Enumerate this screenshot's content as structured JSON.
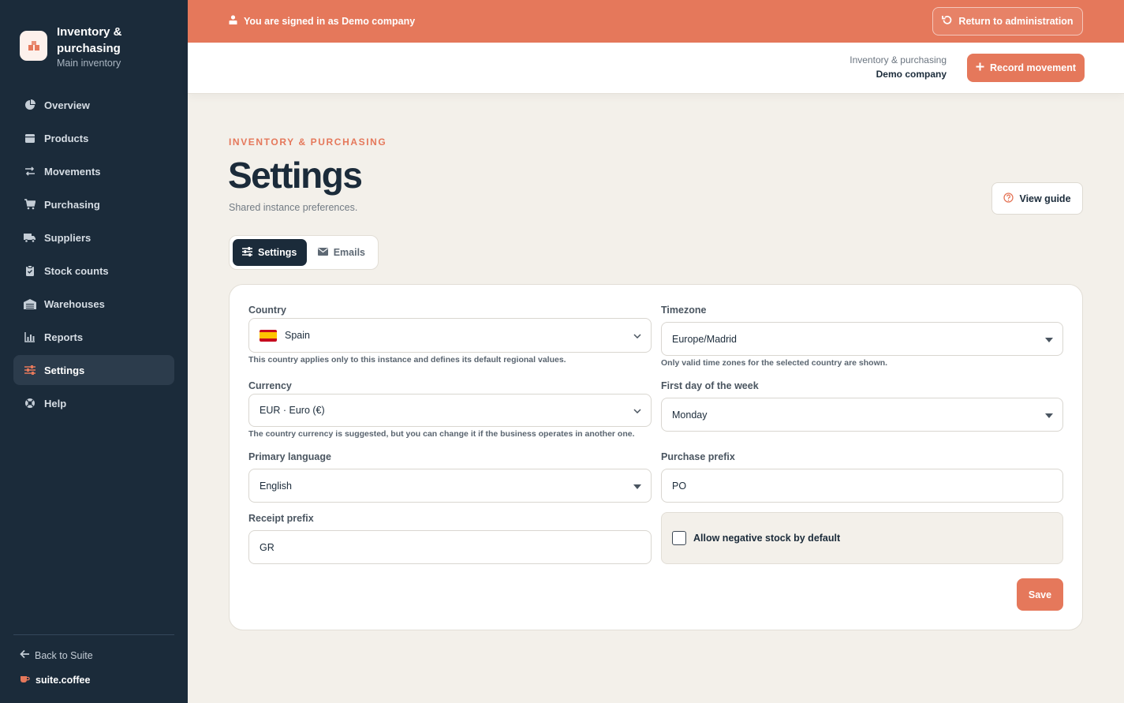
{
  "sidebar": {
    "brand_title": "Inventory & purchasing",
    "brand_sub": "Main inventory",
    "items": [
      {
        "label": "Overview",
        "icon": "pie-chart-icon"
      },
      {
        "label": "Products",
        "icon": "box-icon"
      },
      {
        "label": "Movements",
        "icon": "arrows-icon"
      },
      {
        "label": "Purchasing",
        "icon": "cart-icon"
      },
      {
        "label": "Suppliers",
        "icon": "truck-icon"
      },
      {
        "label": "Stock counts",
        "icon": "clipboard-icon"
      },
      {
        "label": "Warehouses",
        "icon": "warehouse-icon"
      },
      {
        "label": "Reports",
        "icon": "bar-chart-icon"
      },
      {
        "label": "Settings",
        "icon": "sliders-icon",
        "active": true
      },
      {
        "label": "Help",
        "icon": "lifebuoy-icon"
      }
    ],
    "back_label": "Back to Suite",
    "suite_brand": "suite.coffee"
  },
  "banner": {
    "text": "You are signed in as Demo company",
    "return_label": "Return to administration"
  },
  "header": {
    "app_name": "Inventory & purchasing",
    "company": "Demo company",
    "record_label": "Record movement"
  },
  "page": {
    "eyebrow": "INVENTORY & PURCHASING",
    "title": "Settings",
    "subtitle": "Shared instance preferences.",
    "guide_label": "View guide"
  },
  "tabs": [
    {
      "label": "Settings",
      "active": true
    },
    {
      "label": "Emails",
      "active": false
    }
  ],
  "form": {
    "country": {
      "label": "Country",
      "value": "Spain",
      "hint": "This country applies only to this instance and defines its default regional values."
    },
    "timezone": {
      "label": "Timezone",
      "value": "Europe/Madrid",
      "hint": "Only valid time zones for the selected country are shown."
    },
    "currency": {
      "label": "Currency",
      "value": "EUR · Euro (€)",
      "hint": "The country currency is suggested, but you can change it if the business operates in another one."
    },
    "first_day": {
      "label": "First day of the week",
      "value": "Monday"
    },
    "language": {
      "label": "Primary language",
      "value": "English"
    },
    "purchase_prefix": {
      "label": "Purchase prefix",
      "value": "PO"
    },
    "receipt_prefix": {
      "label": "Receipt prefix",
      "value": "GR"
    },
    "negative_stock": {
      "label": "Allow negative stock by default",
      "checked": false
    },
    "save_label": "Save"
  },
  "colors": {
    "accent": "#e5785b",
    "sidebar": "#1b2b3a",
    "background": "#f3f0ea"
  }
}
